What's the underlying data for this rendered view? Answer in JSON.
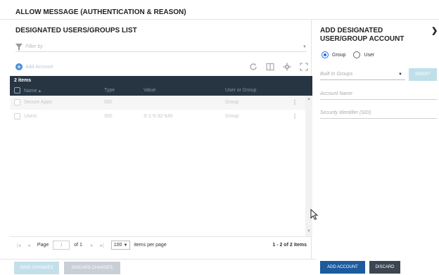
{
  "header": {
    "title": "ALLOW MESSAGE (AUTHENTICATION & REASON)"
  },
  "list_panel": {
    "title": "DESIGNATED USERS/GROUPS LIST",
    "filter_placeholder": "Filter by",
    "add_account_label": "Add Account",
    "toolbar_icons": [
      "refresh-icon",
      "columns-icon",
      "gear-icon",
      "expand-icon"
    ],
    "grid": {
      "count_label": "2 items",
      "columns": [
        "Name ▴",
        "Type",
        "Value",
        "User or Group"
      ],
      "rows": [
        {
          "name": "Secure Apps",
          "type": "SID",
          "value": "",
          "user_or_group": "Group"
        },
        {
          "name": "Users",
          "type": "SID",
          "value": "S-1-5-32-545",
          "user_or_group": "Group"
        }
      ]
    },
    "pager": {
      "first": "|◂",
      "prev": "◂",
      "page_label": "Page",
      "page_value": "1",
      "of_label": "of 1",
      "next": "▸",
      "last": "▸|",
      "per_page_value": "100",
      "per_page_label": "items per page",
      "range": "1 - 2 of 2 items"
    }
  },
  "add_panel": {
    "title": "ADD DESIGNATED USER/GROUP ACCOUNT",
    "radio_group": "Group",
    "radio_user": "User",
    "selected_radio": "Group",
    "builtin_groups_placeholder": "Built In Groups",
    "insert_label": "INSERT",
    "account_name_placeholder": "Account Name",
    "sid_placeholder": "Security Identifier (SID)"
  },
  "footer": {
    "save_changes": "SAVE CHANGES",
    "discard_changes": "DISCARD CHANGES",
    "add_account": "ADD ACCOUNT",
    "discard": "DISCARD"
  },
  "colors": {
    "grid_header_bg": "#273543",
    "primary_button": "#1b5b9e",
    "dark_button": "#3b4652",
    "disabled_teal": "#c3e0ea",
    "radio_accent": "#1e6fd9"
  }
}
